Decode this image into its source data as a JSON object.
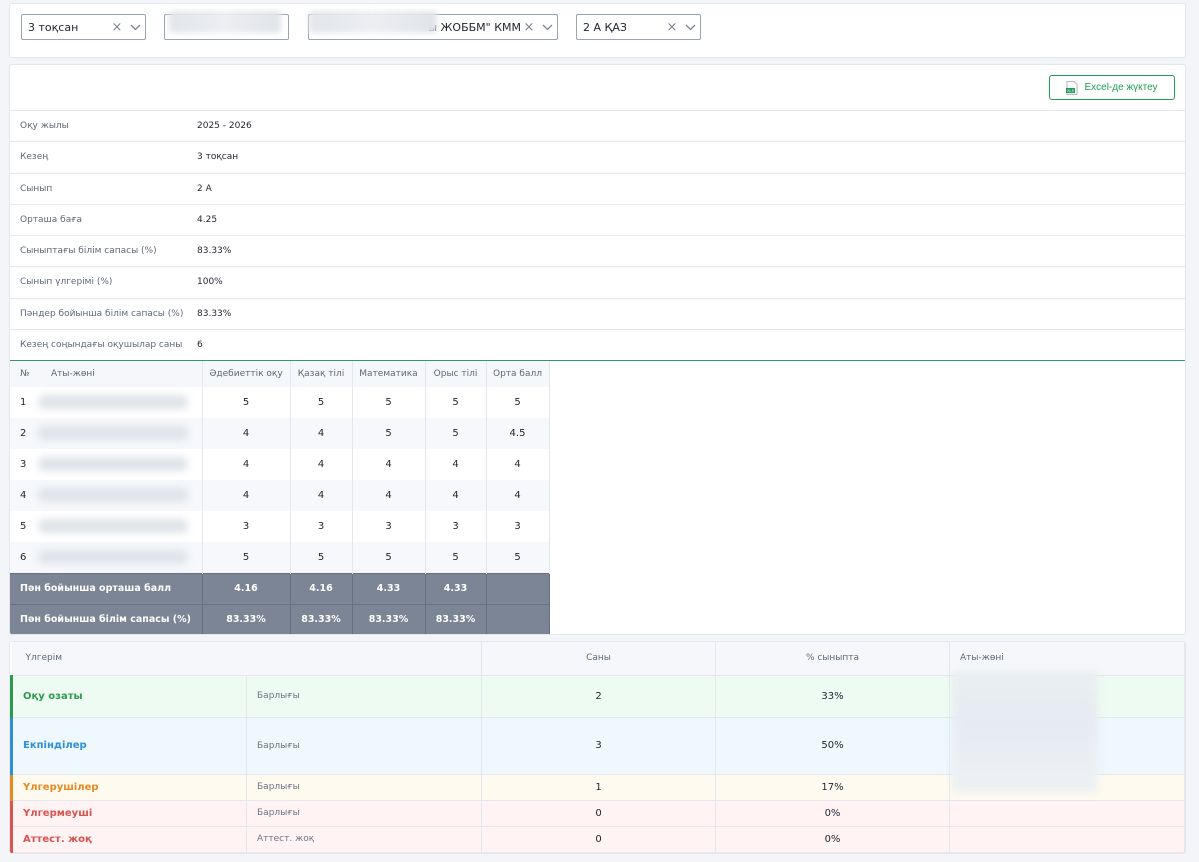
{
  "filters": {
    "quarter": "3 тоқсан",
    "school": "ы ЖОББМ\" КММ",
    "class": "2 А ҚАЗ"
  },
  "export_button": "Excel-де жүктеу",
  "info": [
    {
      "label": "Оқу жылы",
      "value": "2025 - 2026"
    },
    {
      "label": "Кезең",
      "value": "3 тоқсан"
    },
    {
      "label": "Сынып",
      "value": "2 А"
    },
    {
      "label": "Орташа баға",
      "value": "4.25"
    },
    {
      "label": "Сыныптағы білім сапасы (%)",
      "value": "83.33%"
    },
    {
      "label": "Сынып үлгерімі (%)",
      "value": "100%"
    },
    {
      "label": "Пәндер бойынша білім сапасы (%)",
      "value": "83.33%"
    },
    {
      "label": "Кезең соңындағы оқушылар саны",
      "value": "6"
    }
  ],
  "grades": {
    "headers": [
      "№",
      "Аты-жөні",
      "Әдебиеттік оқу",
      "Қазақ тілі",
      "Математика",
      "Орыс тілі",
      "Орта балл"
    ],
    "rows": [
      [
        "1",
        "",
        "5",
        "5",
        "5",
        "5",
        "5"
      ],
      [
        "2",
        "",
        "4",
        "4",
        "5",
        "5",
        "4.5"
      ],
      [
        "3",
        "",
        "4",
        "4",
        "4",
        "4",
        "4"
      ],
      [
        "4",
        "",
        "4",
        "4",
        "4",
        "4",
        "4"
      ],
      [
        "5",
        "",
        "3",
        "3",
        "3",
        "3",
        "3"
      ],
      [
        "6",
        "",
        "5",
        "5",
        "5",
        "5",
        "5"
      ]
    ],
    "footer": [
      {
        "label": "Пән бойынша орташа балл",
        "values": [
          "4.16",
          "4.16",
          "4.33",
          "4.33",
          ""
        ]
      },
      {
        "label": "Пән бойынша білім сапасы (%)",
        "values": [
          "83.33%",
          "83.33%",
          "83.33%",
          "83.33%",
          ""
        ]
      }
    ]
  },
  "progress": {
    "headers": [
      "Үлгерім",
      "Саны",
      "% сыныпта",
      "Аты-жөні"
    ],
    "rows": [
      {
        "category": "Оқу озаты",
        "sub": "Барлығы",
        "count": "2",
        "percent": "33%",
        "color": "#2e9a4e",
        "bg": "#eefbf3"
      },
      {
        "category": "Екпінділер",
        "sub": "Барлығы",
        "count": "3",
        "percent": "50%",
        "color": "#2f8fd6",
        "bg": "#eef8fd"
      },
      {
        "category": "Үлгерушілер",
        "sub": "Барлығы",
        "count": "1",
        "percent": "17%",
        "color": "#e58a1f",
        "bg": "#fffaf0"
      },
      {
        "category": "Үлгермеуші",
        "sub": "Барлығы",
        "count": "0",
        "percent": "0%",
        "color": "#d9534f",
        "bg": "#fff3f3"
      },
      {
        "category": "Аттест. жоқ",
        "sub": "Аттест. жоқ",
        "count": "0",
        "percent": "0%",
        "color": "#d9534f",
        "bg": "#fff3f3"
      }
    ]
  }
}
